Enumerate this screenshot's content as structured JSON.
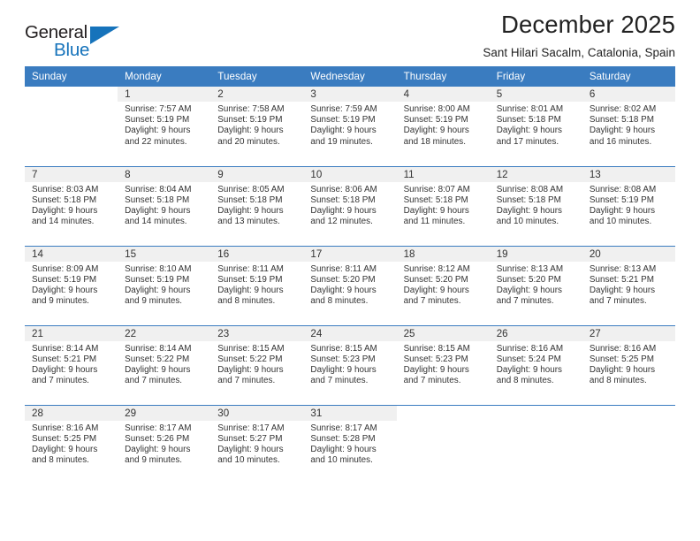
{
  "logo": {
    "word_top": "General",
    "word_bottom": "Blue",
    "accent_color": "#1673bb"
  },
  "header": {
    "title": "December 2025",
    "subtitle": "Sant Hilari Sacalm, Catalonia, Spain",
    "header_bg": "#3a7cc0",
    "daynum_bg": "#f0f0f0"
  },
  "weekday_headers": [
    "Sunday",
    "Monday",
    "Tuesday",
    "Wednesday",
    "Thursday",
    "Friday",
    "Saturday"
  ],
  "labels": {
    "sunrise": "Sunrise:",
    "sunset": "Sunset:",
    "daylight": "Daylight:"
  },
  "weeks": [
    [
      {
        "day": ""
      },
      {
        "day": "1",
        "sunrise": "Sunrise: 7:57 AM",
        "sunset": "Sunset: 5:19 PM",
        "daylight_line1": "Daylight: 9 hours",
        "daylight_line2": "and 22 minutes."
      },
      {
        "day": "2",
        "sunrise": "Sunrise: 7:58 AM",
        "sunset": "Sunset: 5:19 PM",
        "daylight_line1": "Daylight: 9 hours",
        "daylight_line2": "and 20 minutes."
      },
      {
        "day": "3",
        "sunrise": "Sunrise: 7:59 AM",
        "sunset": "Sunset: 5:19 PM",
        "daylight_line1": "Daylight: 9 hours",
        "daylight_line2": "and 19 minutes."
      },
      {
        "day": "4",
        "sunrise": "Sunrise: 8:00 AM",
        "sunset": "Sunset: 5:19 PM",
        "daylight_line1": "Daylight: 9 hours",
        "daylight_line2": "and 18 minutes."
      },
      {
        "day": "5",
        "sunrise": "Sunrise: 8:01 AM",
        "sunset": "Sunset: 5:18 PM",
        "daylight_line1": "Daylight: 9 hours",
        "daylight_line2": "and 17 minutes."
      },
      {
        "day": "6",
        "sunrise": "Sunrise: 8:02 AM",
        "sunset": "Sunset: 5:18 PM",
        "daylight_line1": "Daylight: 9 hours",
        "daylight_line2": "and 16 minutes."
      }
    ],
    [
      {
        "day": "7",
        "sunrise": "Sunrise: 8:03 AM",
        "sunset": "Sunset: 5:18 PM",
        "daylight_line1": "Daylight: 9 hours",
        "daylight_line2": "and 14 minutes."
      },
      {
        "day": "8",
        "sunrise": "Sunrise: 8:04 AM",
        "sunset": "Sunset: 5:18 PM",
        "daylight_line1": "Daylight: 9 hours",
        "daylight_line2": "and 14 minutes."
      },
      {
        "day": "9",
        "sunrise": "Sunrise: 8:05 AM",
        "sunset": "Sunset: 5:18 PM",
        "daylight_line1": "Daylight: 9 hours",
        "daylight_line2": "and 13 minutes."
      },
      {
        "day": "10",
        "sunrise": "Sunrise: 8:06 AM",
        "sunset": "Sunset: 5:18 PM",
        "daylight_line1": "Daylight: 9 hours",
        "daylight_line2": "and 12 minutes."
      },
      {
        "day": "11",
        "sunrise": "Sunrise: 8:07 AM",
        "sunset": "Sunset: 5:18 PM",
        "daylight_line1": "Daylight: 9 hours",
        "daylight_line2": "and 11 minutes."
      },
      {
        "day": "12",
        "sunrise": "Sunrise: 8:08 AM",
        "sunset": "Sunset: 5:18 PM",
        "daylight_line1": "Daylight: 9 hours",
        "daylight_line2": "and 10 minutes."
      },
      {
        "day": "13",
        "sunrise": "Sunrise: 8:08 AM",
        "sunset": "Sunset: 5:19 PM",
        "daylight_line1": "Daylight: 9 hours",
        "daylight_line2": "and 10 minutes."
      }
    ],
    [
      {
        "day": "14",
        "sunrise": "Sunrise: 8:09 AM",
        "sunset": "Sunset: 5:19 PM",
        "daylight_line1": "Daylight: 9 hours",
        "daylight_line2": "and 9 minutes."
      },
      {
        "day": "15",
        "sunrise": "Sunrise: 8:10 AM",
        "sunset": "Sunset: 5:19 PM",
        "daylight_line1": "Daylight: 9 hours",
        "daylight_line2": "and 9 minutes."
      },
      {
        "day": "16",
        "sunrise": "Sunrise: 8:11 AM",
        "sunset": "Sunset: 5:19 PM",
        "daylight_line1": "Daylight: 9 hours",
        "daylight_line2": "and 8 minutes."
      },
      {
        "day": "17",
        "sunrise": "Sunrise: 8:11 AM",
        "sunset": "Sunset: 5:20 PM",
        "daylight_line1": "Daylight: 9 hours",
        "daylight_line2": "and 8 minutes."
      },
      {
        "day": "18",
        "sunrise": "Sunrise: 8:12 AM",
        "sunset": "Sunset: 5:20 PM",
        "daylight_line1": "Daylight: 9 hours",
        "daylight_line2": "and 7 minutes."
      },
      {
        "day": "19",
        "sunrise": "Sunrise: 8:13 AM",
        "sunset": "Sunset: 5:20 PM",
        "daylight_line1": "Daylight: 9 hours",
        "daylight_line2": "and 7 minutes."
      },
      {
        "day": "20",
        "sunrise": "Sunrise: 8:13 AM",
        "sunset": "Sunset: 5:21 PM",
        "daylight_line1": "Daylight: 9 hours",
        "daylight_line2": "and 7 minutes."
      }
    ],
    [
      {
        "day": "21",
        "sunrise": "Sunrise: 8:14 AM",
        "sunset": "Sunset: 5:21 PM",
        "daylight_line1": "Daylight: 9 hours",
        "daylight_line2": "and 7 minutes."
      },
      {
        "day": "22",
        "sunrise": "Sunrise: 8:14 AM",
        "sunset": "Sunset: 5:22 PM",
        "daylight_line1": "Daylight: 9 hours",
        "daylight_line2": "and 7 minutes."
      },
      {
        "day": "23",
        "sunrise": "Sunrise: 8:15 AM",
        "sunset": "Sunset: 5:22 PM",
        "daylight_line1": "Daylight: 9 hours",
        "daylight_line2": "and 7 minutes."
      },
      {
        "day": "24",
        "sunrise": "Sunrise: 8:15 AM",
        "sunset": "Sunset: 5:23 PM",
        "daylight_line1": "Daylight: 9 hours",
        "daylight_line2": "and 7 minutes."
      },
      {
        "day": "25",
        "sunrise": "Sunrise: 8:15 AM",
        "sunset": "Sunset: 5:23 PM",
        "daylight_line1": "Daylight: 9 hours",
        "daylight_line2": "and 7 minutes."
      },
      {
        "day": "26",
        "sunrise": "Sunrise: 8:16 AM",
        "sunset": "Sunset: 5:24 PM",
        "daylight_line1": "Daylight: 9 hours",
        "daylight_line2": "and 8 minutes."
      },
      {
        "day": "27",
        "sunrise": "Sunrise: 8:16 AM",
        "sunset": "Sunset: 5:25 PM",
        "daylight_line1": "Daylight: 9 hours",
        "daylight_line2": "and 8 minutes."
      }
    ],
    [
      {
        "day": "28",
        "sunrise": "Sunrise: 8:16 AM",
        "sunset": "Sunset: 5:25 PM",
        "daylight_line1": "Daylight: 9 hours",
        "daylight_line2": "and 8 minutes."
      },
      {
        "day": "29",
        "sunrise": "Sunrise: 8:17 AM",
        "sunset": "Sunset: 5:26 PM",
        "daylight_line1": "Daylight: 9 hours",
        "daylight_line2": "and 9 minutes."
      },
      {
        "day": "30",
        "sunrise": "Sunrise: 8:17 AM",
        "sunset": "Sunset: 5:27 PM",
        "daylight_line1": "Daylight: 9 hours",
        "daylight_line2": "and 10 minutes."
      },
      {
        "day": "31",
        "sunrise": "Sunrise: 8:17 AM",
        "sunset": "Sunset: 5:28 PM",
        "daylight_line1": "Daylight: 9 hours",
        "daylight_line2": "and 10 minutes."
      },
      {
        "day": ""
      },
      {
        "day": ""
      },
      {
        "day": ""
      }
    ]
  ]
}
